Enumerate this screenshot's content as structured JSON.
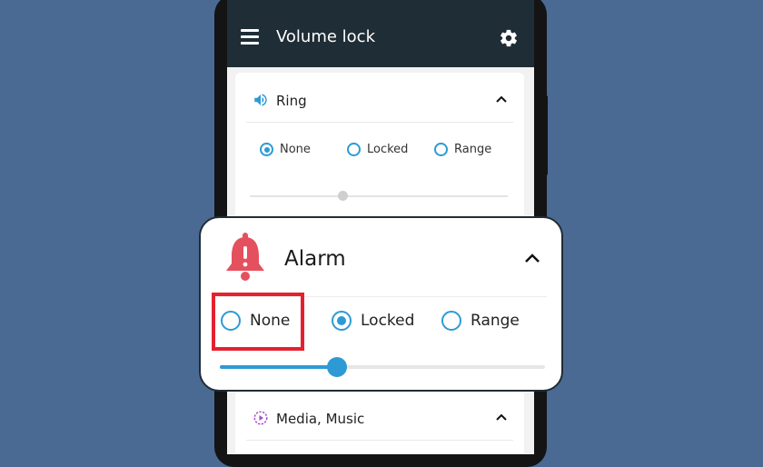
{
  "app": {
    "title": "Volume lock"
  },
  "ring": {
    "label": "Ring",
    "options": [
      "None",
      "Locked",
      "Range"
    ],
    "selected": "None",
    "volume_fraction": 0.36,
    "icon": "speaker-icon"
  },
  "alarm": {
    "label": "Alarm",
    "options": [
      "None",
      "Locked",
      "Range"
    ],
    "selected": "Locked",
    "highlighted_option": "None",
    "volume_fraction": 0.36,
    "icon": "alarm-bell-icon"
  },
  "media": {
    "label": "Media, Music",
    "icon": "media-play-icon"
  },
  "colors": {
    "background": "#4b6a93",
    "appbar": "#1f2d36",
    "accent": "#2d9ad6",
    "highlight": "#e5212f",
    "bell": "#e5505f"
  }
}
